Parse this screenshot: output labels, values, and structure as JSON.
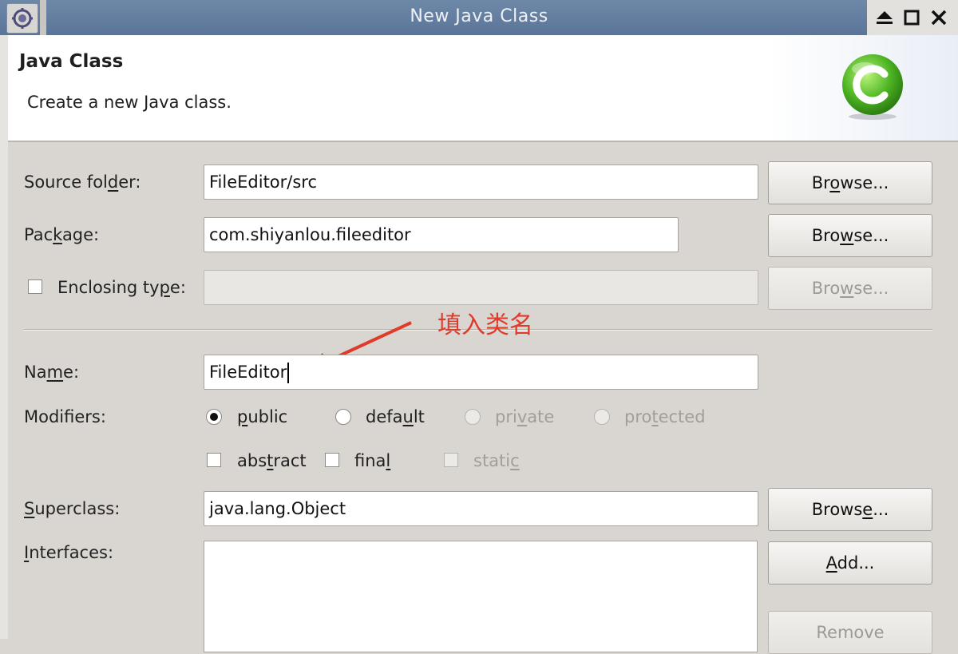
{
  "window": {
    "title": "New Java Class"
  },
  "header": {
    "title": "Java Class",
    "description": "Create a new Java class."
  },
  "form": {
    "source_folder": {
      "label_pre": "Source fol",
      "label_mn": "d",
      "label_post": "er:",
      "value": "FileEditor/src",
      "browse_pre": "Br",
      "browse_mn": "o",
      "browse_post": "wse..."
    },
    "package": {
      "label_pre": "Pac",
      "label_mn": "k",
      "label_post": "age:",
      "value": "com.shiyanlou.fileeditor",
      "browse_pre": "Bro",
      "browse_mn": "w",
      "browse_post": "se..."
    },
    "enclosing_type": {
      "label_pre": "Enclosing ty",
      "label_mn": "p",
      "label_post": "e:",
      "value": "",
      "browse_pre": "Bro",
      "browse_mn": "w",
      "browse_post": "se..."
    },
    "name": {
      "label_pre": "Na",
      "label_mn": "m",
      "label_post": "e:",
      "value": "FileEditor"
    },
    "modifiers": {
      "label": "Modifiers:",
      "public": {
        "pre": "",
        "mn": "p",
        "post": "ublic"
      },
      "default": {
        "pre": "defa",
        "mn": "u",
        "post": "lt"
      },
      "private": {
        "pre": "pri",
        "mn": "v",
        "post": "ate"
      },
      "protected": {
        "pre": "pro",
        "mn": "t",
        "post": "ected"
      },
      "abstract": {
        "pre": "abs",
        "mn": "t",
        "post": "ract"
      },
      "final": {
        "pre": "fina",
        "mn": "l",
        "post": ""
      },
      "static": {
        "pre": "stati",
        "mn": "c",
        "post": ""
      }
    },
    "superclass": {
      "label_pre": "",
      "label_mn": "S",
      "label_post": "uperclass:",
      "value": "java.lang.Object",
      "browse_pre": "Brows",
      "browse_mn": "e",
      "browse_post": "..."
    },
    "interfaces": {
      "label_pre": "",
      "label_mn": "I",
      "label_post": "nterfaces:",
      "add_pre": "",
      "add_mn": "A",
      "add_post": "dd...",
      "remove_label": "Remove"
    }
  },
  "annotation": {
    "text": "填入类名",
    "color": "#e03a2a"
  }
}
